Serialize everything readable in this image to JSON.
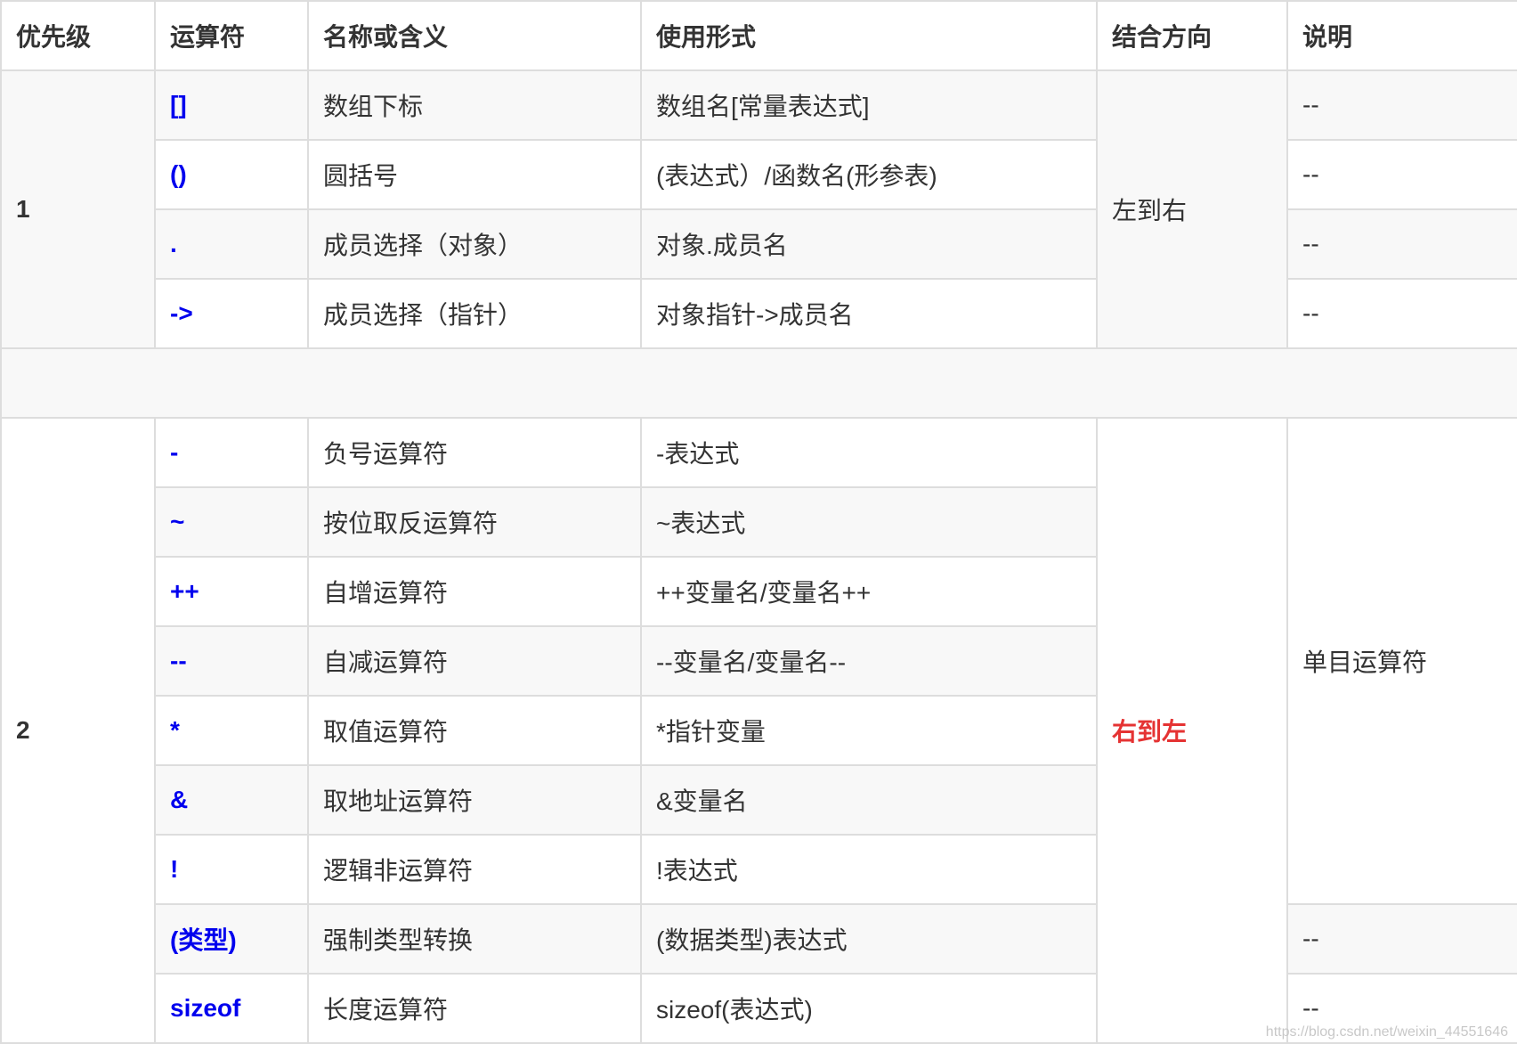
{
  "headers": [
    "优先级",
    "运算符",
    "名称或含义",
    "使用形式",
    "结合方向",
    "说明"
  ],
  "group1": {
    "level": "1",
    "assoc": "左到右",
    "rows": [
      {
        "op": "[]",
        "name": "数组下标",
        "form": "数组名[常量表达式]",
        "note": "--"
      },
      {
        "op": "()",
        "name": "圆括号",
        "form": "(表达式）/函数名(形参表)",
        "note": "--"
      },
      {
        "op": ".",
        "name": "成员选择（对象）",
        "form": "对象.成员名",
        "note": "--"
      },
      {
        "op": "->",
        "name": "成员选择（指针）",
        "form": "对象指针->成员名",
        "note": "--"
      }
    ]
  },
  "group2": {
    "level": "2",
    "assoc": "右到左",
    "note_merged": "单目运算符",
    "rows": [
      {
        "op": "-",
        "name": "负号运算符",
        "form": "-表达式"
      },
      {
        "op": "~",
        "name": "按位取反运算符",
        "form": "~表达式"
      },
      {
        "op": "++",
        "name": "自增运算符",
        "form": "++变量名/变量名++"
      },
      {
        "op": "--",
        "name": "自减运算符",
        "form": "--变量名/变量名--"
      },
      {
        "op": "*",
        "name": "取值运算符",
        "form": "*指针变量"
      },
      {
        "op": "&",
        "name": "取地址运算符",
        "form": "&变量名"
      },
      {
        "op": "!",
        "name": "逻辑非运算符",
        "form": "!表达式"
      },
      {
        "op": "(类型)",
        "name": "强制类型转换",
        "form": "(数据类型)表达式",
        "note": "--"
      },
      {
        "op": "sizeof",
        "name": "长度运算符",
        "form": "sizeof(表达式)",
        "note": "--"
      }
    ]
  },
  "watermark": "https://blog.csdn.net/weixin_44551646"
}
